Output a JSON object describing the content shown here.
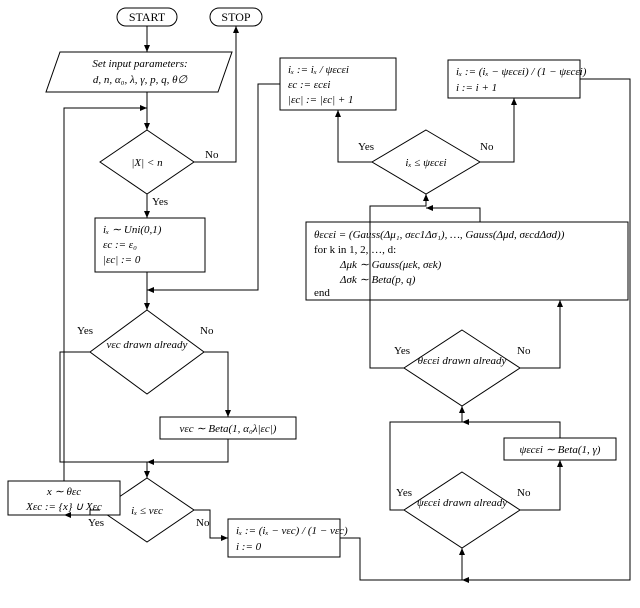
{
  "start": "START",
  "stop": "STOP",
  "params_title": "Set input parameters:",
  "params_vars": "d,  n,  α₀,  λ,  γ,  p,  q,  θ∅",
  "cond_size": "|X|  <  n",
  "draw_ix": "iₓ ∼ Uni(0,1)",
  "eps_init1": "εc := ε₀",
  "eps_init2": "|εc| := 0",
  "cond_nu": "νεc drawn already",
  "nu_draw": "νεc ∼ Beta(1, α₀λ|εc|)",
  "cond_ix_nu": "iₓ ≤ νεc",
  "sample_x1": "x ∼ θεc",
  "sample_x2": "Xεc := {x} ∪ Xεc",
  "ix_update1": "iₓ := (iₓ − νεc) / (1 − νεc)",
  "ix_update2": "i := 0",
  "cond_psi": "ψεcεi drawn already",
  "psi_draw": "ψεcεi ∼ Beta(1, γ)",
  "cond_theta": "θεcεi drawn already",
  "theta_line1": "θεcεi = (Gauss(Δμ₁, σεc1Δσ₁), …, Gauss(Δμd, σεcdΔσd))",
  "theta_line2": "for k in 1, 2, …, d:",
  "theta_line3": "Δμk ∼ Gauss(μεk, σεk)",
  "theta_line4": "Δσk ∼ Beta(p, q)",
  "theta_line5": "end",
  "cond_ix_psi": "iₓ ≤ ψεcεi",
  "left_upd1": "iₓ := iₓ / ψεcεi",
  "left_upd2": "εc := εcεi",
  "left_upd3": "|εc| := |εc| + 1",
  "right_upd1": "iₓ := (iₓ − ψεcεi) / (1 − ψεcεi)",
  "right_upd2": "i := i + 1",
  "yes": "Yes",
  "no": "No"
}
